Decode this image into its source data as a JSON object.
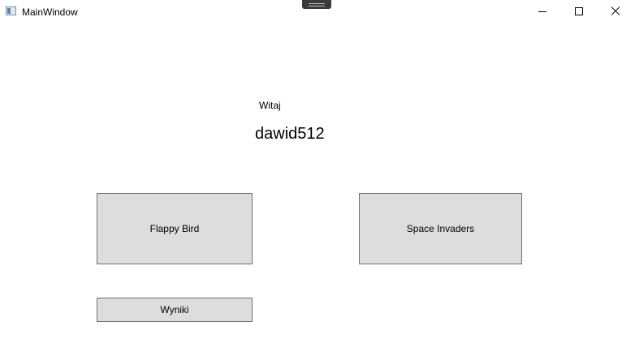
{
  "window": {
    "title": "MainWindow",
    "icon": "app-window-icon",
    "controls": [
      "minimize-icon",
      "maximize-icon",
      "close-icon"
    ]
  },
  "main": {
    "greeting": "Witaj",
    "username": "dawid512",
    "buttons": {
      "flappy_bird": "Flappy Bird",
      "space_invaders": "Space Invaders",
      "scores": "Wyniki"
    }
  }
}
